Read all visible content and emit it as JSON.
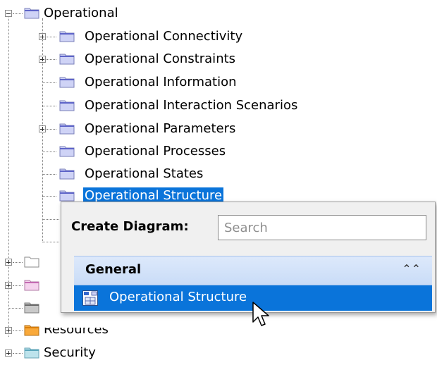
{
  "tree": {
    "root": {
      "label": "Operational",
      "expanded": true
    },
    "children": [
      {
        "label": "Operational Connectivity",
        "has_children": true
      },
      {
        "label": "Operational Constraints",
        "has_children": true
      },
      {
        "label": "Operational Information",
        "has_children": false
      },
      {
        "label": "Operational Interaction Scenarios",
        "has_children": false
      },
      {
        "label": "Operational Parameters",
        "has_children": true
      },
      {
        "label": "Operational Processes",
        "has_children": false
      },
      {
        "label": "Operational States",
        "has_children": false
      },
      {
        "label": "Operational Structure",
        "has_children": false,
        "selected": true
      }
    ],
    "siblings": [
      {
        "label": "Resources",
        "has_children": true
      },
      {
        "label": "Security",
        "has_children": true
      }
    ]
  },
  "popup": {
    "title": "Create Diagram:",
    "search_placeholder": "Search",
    "group_label": "General",
    "collapse_icon": "double-chevron-up-icon",
    "item_label": "Operational Structure",
    "item_icon": "operational-structure-diagram-icon"
  },
  "colors": {
    "selection": "#0a74da",
    "folder_blue": "#cfd3f6",
    "folder_pink": "#f5d3ee",
    "folder_gray": "#c9c9c9",
    "folder_orange": "#f9a93a",
    "folder_cyan": "#bde3ec"
  }
}
